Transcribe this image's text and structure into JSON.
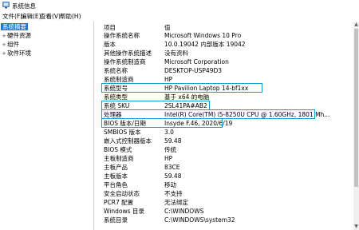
{
  "window": {
    "title": "系统信息"
  },
  "menu": [
    "文件(F)",
    "编辑(E)",
    "查看(V)",
    "帮助(H)"
  ],
  "tree": [
    {
      "label": "系统摘要",
      "selected": true
    },
    {
      "label": "硬件资源",
      "expander": "+"
    },
    {
      "label": "组件",
      "expander": "+"
    },
    {
      "label": "软件环境",
      "expander": "+"
    }
  ],
  "table": {
    "columns": [
      "项目",
      "值"
    ],
    "rows": [
      [
        "操作系统名称",
        "Microsoft Windows 10 Pro"
      ],
      [
        "版本",
        "10.0.19042 内部版本 19042"
      ],
      [
        "其他操作系统描述",
        "没有资料"
      ],
      [
        "操作系统制造商",
        "Microsoft Corporation"
      ],
      [
        "系统名称",
        "DESKTOP-USP49D3"
      ],
      [
        "系统制造商",
        "HP"
      ],
      [
        "系统型号",
        "HP Pavilion Laptop 14-bf1xx"
      ],
      [
        "系统类型",
        "基于 x64 的电脑"
      ],
      [
        "系统 SKU",
        "2SL41PA#AB2"
      ],
      [
        "处理器",
        "Intel(R) Core(TM) i5-8250U CPU @ 1.60GHz, 1801 Mh..."
      ],
      [
        "BIOS 版本/日期",
        "Insyde F.46, 2020/6/19"
      ],
      [
        "SMBIOS 版本",
        "3.0"
      ],
      [
        "嵌入式控制器版本",
        "59.48"
      ],
      [
        "BIOS 模式",
        "传统"
      ],
      [
        "主板制造商",
        "HP"
      ],
      [
        "主板产品",
        "83CE"
      ],
      [
        "主板版本",
        "59.48"
      ],
      [
        "平台角色",
        "移动"
      ],
      [
        "安全启动状态",
        "不支持"
      ],
      [
        "PCR7 配置",
        "无法绑定"
      ],
      [
        "Windows 目录",
        "C:\\WINDOWS"
      ],
      [
        "系统目录",
        "C:\\WINDOWS\\system32"
      ]
    ]
  },
  "colors": {
    "selection": "#1e77d3",
    "highlight_border": "#0aa3cf"
  },
  "icons": {
    "app": "system-info-icon"
  }
}
